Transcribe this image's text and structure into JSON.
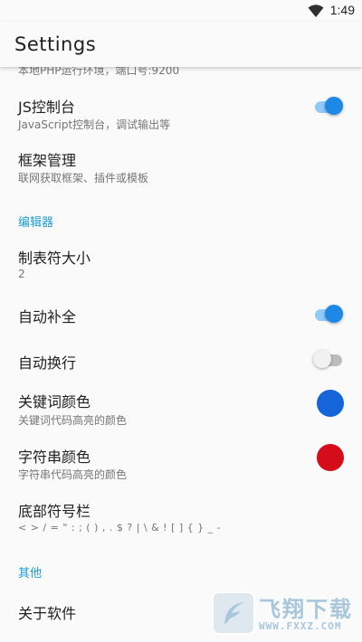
{
  "status_bar": {
    "time": "1:49",
    "wifi_icon": "wifi-icon"
  },
  "app_bar": {
    "title": "Settings"
  },
  "colors": {
    "accent": "#1e88e5",
    "category": "#1e9bd7",
    "keyword_color": "#1565d8",
    "string_color": "#d50d1a"
  },
  "items": {
    "php_env": {
      "summary": "本地PHP运行环境，端口号:9200"
    },
    "js_console": {
      "title": "JS控制台",
      "summary": "JavaScript控制台，调试输出等",
      "enabled": true
    },
    "framework": {
      "title": "框架管理",
      "summary": "联网获取框架、插件或模板"
    },
    "editor_category": "编辑器",
    "tab_size": {
      "title": "制表符大小",
      "value": "2"
    },
    "autocomplete": {
      "title": "自动补全",
      "enabled": true
    },
    "word_wrap": {
      "title": "自动换行",
      "enabled": false
    },
    "keyword_color": {
      "title": "关键词颜色",
      "summary": "关键词代码高亮的颜色"
    },
    "string_color": {
      "title": "字符串颜色",
      "summary": "字符串代码高亮的颜色"
    },
    "symbol_bar": {
      "title": "底部符号栏",
      "symbols": "< > / = \" : ; ( ) , . $ ? | \\ & ! [ ] { } _ -"
    },
    "other_category": "其他",
    "about": {
      "title": "关于软件"
    }
  },
  "watermark": {
    "text": "飞翔下载",
    "url": "WWW.FXXZ.COM"
  }
}
